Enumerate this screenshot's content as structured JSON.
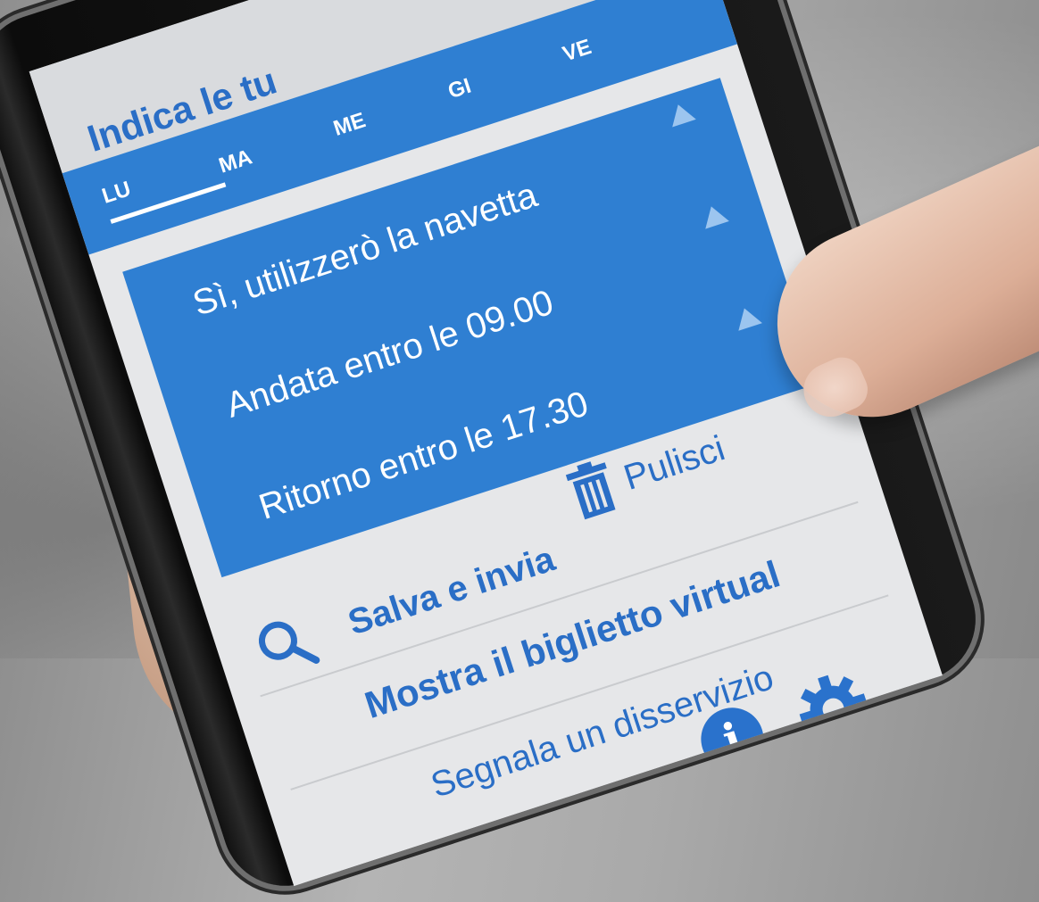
{
  "header": {
    "title": "Indica le tu"
  },
  "days": [
    {
      "label": "LU",
      "active": true
    },
    {
      "label": "MA",
      "active": false
    },
    {
      "label": "ME",
      "active": false
    },
    {
      "label": "GI",
      "active": false
    },
    {
      "label": "VE",
      "active": false
    }
  ],
  "options": [
    {
      "label": "Sì, utilizzerò la navetta",
      "icon": "triangle-up-icon"
    },
    {
      "label": "Andata entro le 09.00",
      "icon": "triangle-up-icon"
    },
    {
      "label": "Ritorno entro le 17.30",
      "icon": "triangle-up-icon"
    }
  ],
  "actions": {
    "save_label": "Salva e invia",
    "clear_label": "Pulisci",
    "ticket_label": "Mostra il biglietto virtual",
    "report_label": "Segnala un disservizio"
  },
  "icons": {
    "search": "search-icon",
    "trash": "trash-icon",
    "info": "info-icon",
    "settings": "gear-icon"
  },
  "colors": {
    "primary": "#2f7fd2",
    "accent_text": "#2a6ec6",
    "background": "#e6e7e9"
  }
}
